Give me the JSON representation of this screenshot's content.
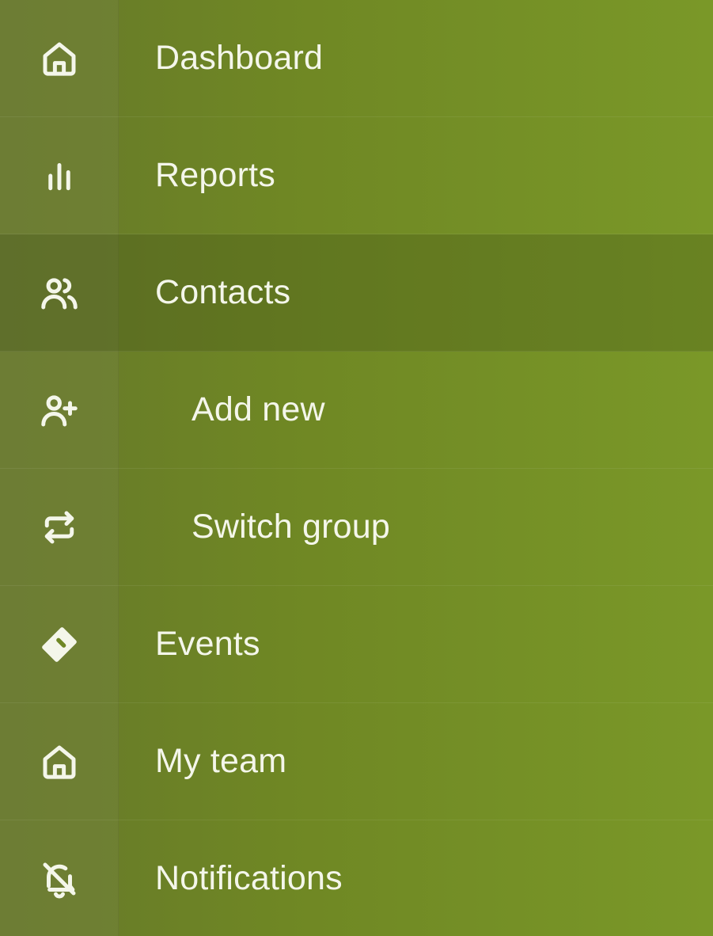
{
  "menu": {
    "items": [
      {
        "label": "Dashboard",
        "icon": "home-icon",
        "active": false
      },
      {
        "label": "Reports",
        "icon": "bar-chart-icon",
        "active": false
      },
      {
        "label": "Contacts",
        "icon": "users-icon",
        "active": true
      },
      {
        "label": "Add new",
        "icon": "user-plus-icon",
        "active": false
      },
      {
        "label": "Switch group",
        "icon": "switch-arrows-icon",
        "active": false
      },
      {
        "label": "Events",
        "icon": "ticket-icon",
        "active": false
      },
      {
        "label": "My team",
        "icon": "home-icon",
        "active": false
      },
      {
        "label": "Notifications",
        "icon": "bell-off-icon",
        "active": false
      }
    ]
  },
  "colors": {
    "background_left": "#66782a",
    "background_right": "#7a9828",
    "text": "#f4f6ea",
    "active_overlay": "#4a5c1c"
  }
}
